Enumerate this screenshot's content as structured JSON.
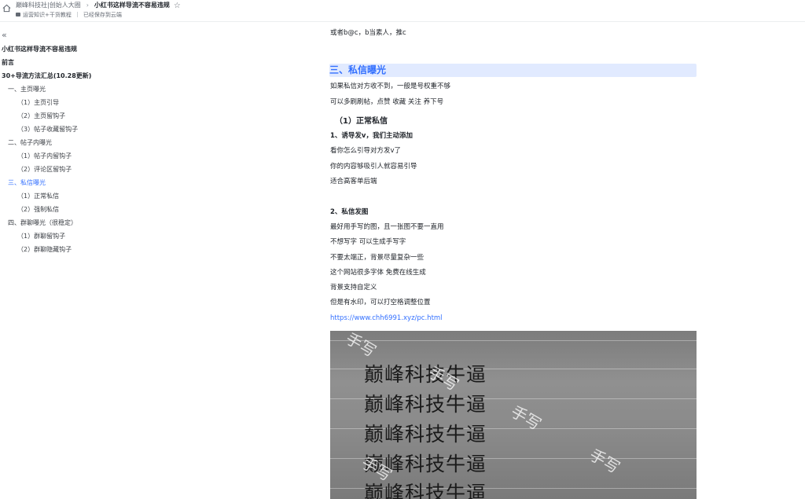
{
  "header": {
    "breadcrumb_parent": "巅峰科技社|创始人大圈",
    "breadcrumb_sep": "›",
    "doc_title": "小红书这样导流不容易违规",
    "folder_label": "运营知识+干货教程",
    "save_status": "已经保存到云端"
  },
  "sidebar": {
    "collapse_symbol": "«",
    "toc": [
      {
        "label": "小红书这样导流不容易违规",
        "level": 0
      },
      {
        "label": "前言",
        "level": 0
      },
      {
        "label": "30+导流方法汇总(10.28更新)",
        "level": 0
      },
      {
        "label": "一、主页曝光",
        "level": 1
      },
      {
        "label": "（1）主页引导",
        "level": 2
      },
      {
        "label": "（2）主页留钩子",
        "level": 2
      },
      {
        "label": "（3）帖子收藏留钩子",
        "level": 2
      },
      {
        "label": "二、帖子内曝光",
        "level": 1
      },
      {
        "label": "（1）帖子内留钩子",
        "level": 2
      },
      {
        "label": "（2）评论区留钩子",
        "level": 2
      },
      {
        "label": "三、私信曝光",
        "level": 1,
        "active": true
      },
      {
        "label": "（1）正常私信",
        "level": 2
      },
      {
        "label": "（2）强制私信",
        "level": 2
      },
      {
        "label": "四、群聊曝光（很稳定）",
        "level": 1
      },
      {
        "label": "（1）群聊留钩子",
        "level": 2
      },
      {
        "label": "（2）群聊隐藏钩子",
        "level": 2
      }
    ]
  },
  "doc": {
    "line_top": "或者b@c，b当素人，推c",
    "section_heading": "三、私信曝光",
    "p1": "如果私信对方收不到，一般是号权重不够",
    "p2": "可以多刷刷帖，点赞 收藏 关注 养下号",
    "subheading": "（1）正常私信",
    "item1_title": "1、诱导发v，我们主动添加",
    "item1_l1": "看你怎么引导对方发v了",
    "item1_l2": "你的内容够吸引人就容易引导",
    "item1_l3": "适合高客单后端",
    "item2_title": "2、私信发图",
    "item2_l1": "最好用手写的图，且一张图不要一直用",
    "item2_l2": "不想写字 可以生成手写字",
    "item2_l3": "不要太端正，背景尽量复杂一些",
    "item2_l4": "这个网站很多字体 免费在线生成",
    "item2_l5": "背景支持自定义",
    "item2_l6": "但是有水印，可以打空格调整位置",
    "link": "https://www.chh6991.xyz/pc.html"
  },
  "image": {
    "handwriting": [
      "巅峰科技牛逼",
      "巅峰科技牛逼",
      "巅峰科技牛逼",
      "巅峰科技牛逼",
      "巅峰科技牛逼"
    ],
    "watermark": "手写"
  },
  "colors": {
    "accent": "#3370ff",
    "heading_bg": "#e1eaff"
  }
}
